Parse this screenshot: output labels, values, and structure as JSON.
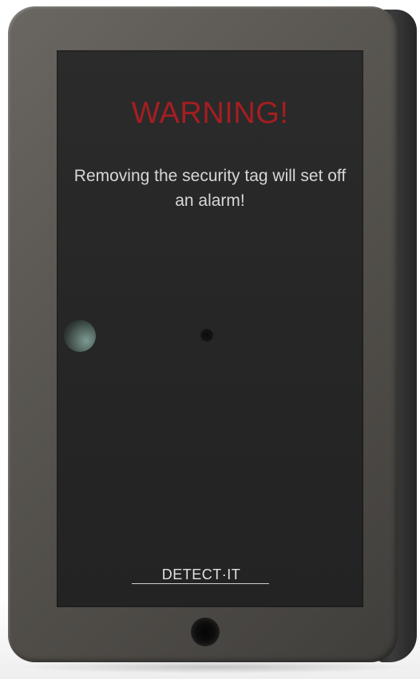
{
  "device": {
    "warning_title": "WARNING!",
    "warning_message": "Removing the security tag will set off an alarm!",
    "brand": "DETECT·IT"
  },
  "colors": {
    "warning_red": "#a51e22",
    "panel": "#262626",
    "enclosure": "#5a5752",
    "text": "#d7d7d7"
  },
  "icons": {
    "sensor_led": "sensor-led-icon",
    "sensor_hole": "sensor-hole-icon",
    "screw_hole": "screw-hole-icon"
  }
}
